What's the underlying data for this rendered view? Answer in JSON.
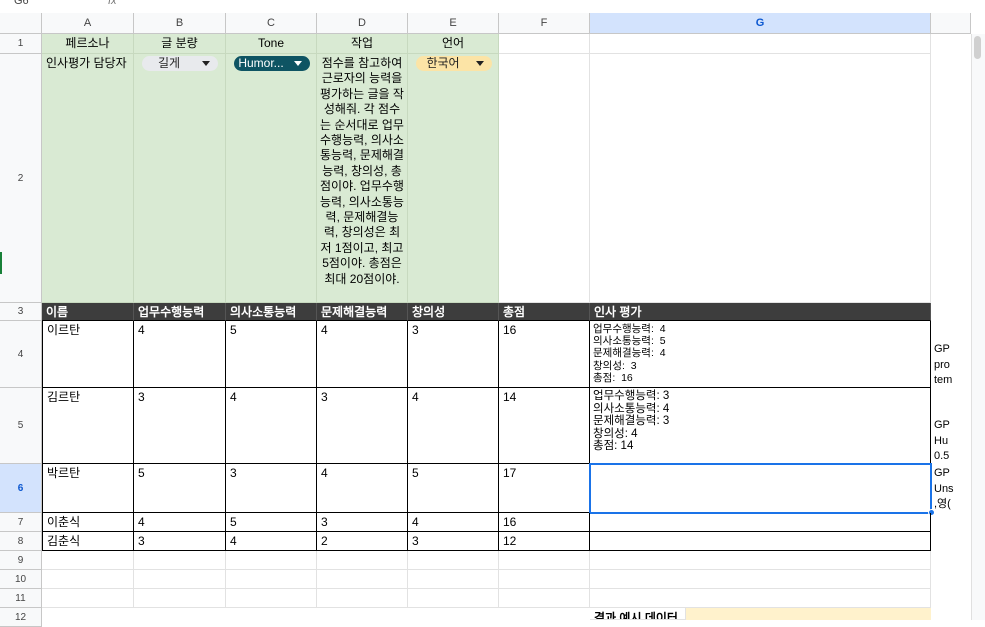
{
  "formula_bar": {
    "cell_ref": "G6",
    "fx": "fx"
  },
  "columns": [
    "A",
    "B",
    "C",
    "D",
    "E",
    "F",
    "G"
  ],
  "rows": [
    "1",
    "2",
    "3",
    "4",
    "5",
    "6",
    "7",
    "8",
    "9",
    "10",
    "11",
    "12"
  ],
  "row1": {
    "persona": "페르소나",
    "length": "글 분량",
    "tone": "Tone",
    "task": "작업",
    "lang": "언어"
  },
  "row2": {
    "persona": "인사평가 담당자",
    "length_chip": "길게",
    "tone_chip": "Humor...",
    "lang_chip": "한국어",
    "task": "점수를 참고하여 근로자의 능력을 평가하는 글을 작성해줘. 각 점수는 순서대로 업무수행능력, 의사소통능력, 문제해결능력, 창의성, 총점이야. 업무수행능력, 의사소통능력, 문제해결능력, 창의성은 최저 1점이고, 최고 5점이야. 총점은 최대 20점이야."
  },
  "table_header": [
    "이름",
    "업무수행능력",
    "의사소통능력",
    "문제해결능력",
    "창의성",
    "총점",
    "인사 평가"
  ],
  "table_rows": [
    {
      "name": "이르탄",
      "v1": "4",
      "v2": "5",
      "v3": "4",
      "v4": "3",
      "total": "16",
      "eval": "업무수행능력:  4\n의사소통능력:  5\n문제해결능력:  4\n창의성:  3\n총점:  16"
    },
    {
      "name": "김르탄",
      "v1": "3",
      "v2": "4",
      "v3": "3",
      "v4": "4",
      "total": "14",
      "eval": "업무수행능력: 3\n의사소통능력: 4\n문제해결능력: 3\n창의성: 4\n총점: 14"
    },
    {
      "name": "박르탄",
      "v1": "5",
      "v2": "3",
      "v3": "4",
      "v4": "5",
      "total": "17",
      "eval": ""
    },
    {
      "name": "이춘식",
      "v1": "4",
      "v2": "5",
      "v3": "3",
      "v4": "4",
      "total": "16",
      "eval": ""
    },
    {
      "name": "김춘식",
      "v1": "3",
      "v2": "4",
      "v3": "2",
      "v4": "3",
      "total": "12",
      "eval": ""
    }
  ],
  "overflow_h": {
    "r4": "GP\npro\ntem",
    "r5": "GP\nHu\n0.5",
    "r6": "GP\nUns\n,영("
  },
  "row12": {
    "label": "결과 예시 데이터"
  },
  "colors": {
    "green": "#d9ead3",
    "dark_header": "#3d3d3d",
    "tone_chip": "#0e5463",
    "lang_chip": "#fce4a6",
    "length_chip": "#e8eaed",
    "selection": "#1a73e8",
    "row12_fill": "#fff2cc"
  }
}
